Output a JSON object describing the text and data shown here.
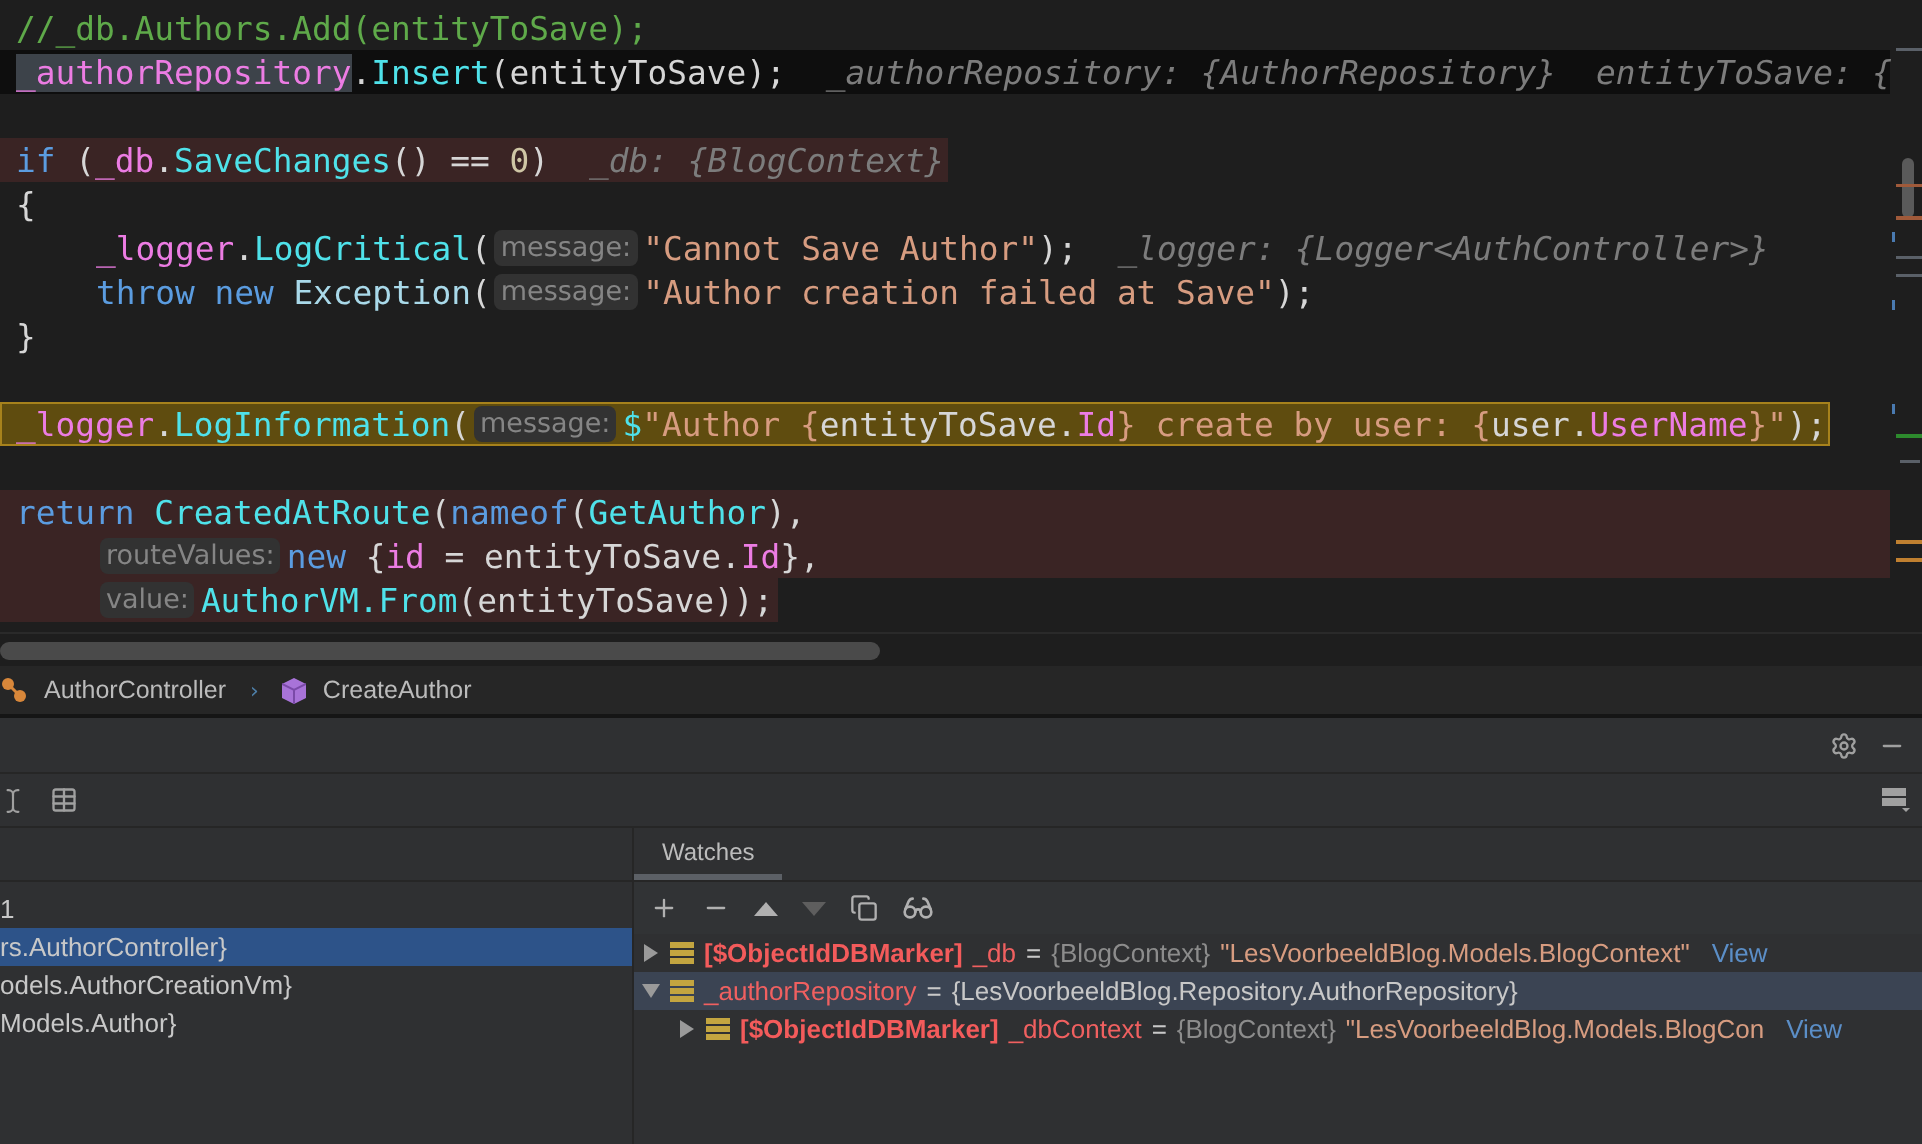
{
  "editor": {
    "lines": [
      {
        "kind": "plain",
        "tokens": [
          {
            "kind": "comment",
            "text": "//_db.Authors.Add(entityToSave);"
          }
        ]
      },
      {
        "kind": "current",
        "tokens": [
          {
            "kind": "field-selected",
            "text": "_authorRepository"
          },
          {
            "kind": "plain",
            "text": "."
          },
          {
            "kind": "method",
            "text": "Insert"
          },
          {
            "kind": "plain",
            "text": "(entityToSave);"
          },
          {
            "kind": "inline",
            "text": "_authorRepository: {AuthorRepository}"
          },
          {
            "kind": "inline",
            "text": "entityToSave: {"
          }
        ]
      },
      {
        "kind": "plain"
      },
      {
        "kind": "breakpoint",
        "tokens": [
          {
            "kind": "keyword",
            "text": "if"
          },
          {
            "kind": "plain",
            "text": " ("
          },
          {
            "kind": "field",
            "text": "_db"
          },
          {
            "kind": "plain",
            "text": "."
          },
          {
            "kind": "method",
            "text": "SaveChanges"
          },
          {
            "kind": "plain",
            "text": "() == "
          },
          {
            "kind": "number",
            "text": "0"
          },
          {
            "kind": "plain",
            "text": ")"
          },
          {
            "kind": "inline",
            "text": "_db: {BlogContext}"
          }
        ]
      },
      {
        "kind": "plain",
        "tokens": [
          {
            "kind": "plain",
            "text": "{"
          }
        ]
      },
      {
        "kind": "plain",
        "indented": true,
        "tokens": [
          {
            "kind": "field",
            "text": "_logger"
          },
          {
            "kind": "plain",
            "text": "."
          },
          {
            "kind": "method",
            "text": "LogCritical"
          },
          {
            "kind": "plain",
            "text": "("
          },
          {
            "kind": "hint",
            "text": "message:"
          },
          {
            "kind": "string",
            "text": "\"Cannot Save Author\""
          },
          {
            "kind": "plain",
            "text": ");"
          },
          {
            "kind": "inline",
            "text": "_logger: {Logger<AuthController>}"
          }
        ]
      },
      {
        "kind": "plain",
        "indented": true,
        "tokens": [
          {
            "kind": "keyword",
            "text": "throw new "
          },
          {
            "kind": "type",
            "text": "Exception"
          },
          {
            "kind": "plain",
            "text": "("
          },
          {
            "kind": "hint",
            "text": "message:"
          },
          {
            "kind": "string",
            "text": "\"Author creation failed at Save\""
          },
          {
            "kind": "plain",
            "text": ");"
          }
        ]
      },
      {
        "kind": "plain",
        "tokens": [
          {
            "kind": "plain",
            "text": "}"
          }
        ]
      },
      {
        "kind": "plain"
      },
      {
        "kind": "logpoint",
        "tokens": [
          {
            "kind": "field",
            "text": "_logger"
          },
          {
            "kind": "plain",
            "text": "."
          },
          {
            "kind": "method",
            "text": "LogInformation"
          },
          {
            "kind": "plain",
            "text": "("
          },
          {
            "kind": "hint",
            "text": "message:"
          },
          {
            "kind": "method",
            "text": "$"
          },
          {
            "kind": "string",
            "text": "\"Author {"
          },
          {
            "kind": "plain",
            "text": "entityToSave."
          },
          {
            "kind": "field",
            "text": "Id"
          },
          {
            "kind": "string",
            "text": "} create by user: {"
          },
          {
            "kind": "plain",
            "text": "user."
          },
          {
            "kind": "field",
            "text": "UserName"
          },
          {
            "kind": "string",
            "text": "}\""
          },
          {
            "kind": "plain",
            "text": ");"
          }
        ]
      },
      {
        "kind": "plain"
      },
      {
        "kind": "breakpoint-block",
        "tokens": [
          {
            "kind": "keyword",
            "text": "return "
          },
          {
            "kind": "method",
            "text": "CreatedAtRoute"
          },
          {
            "kind": "plain",
            "text": "("
          },
          {
            "kind": "keyword",
            "text": "nameof"
          },
          {
            "kind": "plain",
            "text": "("
          },
          {
            "kind": "method",
            "text": "GetAuthor"
          },
          {
            "kind": "plain",
            "text": "),"
          }
        ]
      },
      {
        "kind": "breakpoint-block",
        "indented": true,
        "tokens": [
          {
            "kind": "hint",
            "text": "routeValues:"
          },
          {
            "kind": "keyword",
            "text": "new "
          },
          {
            "kind": "plain",
            "text": "{"
          },
          {
            "kind": "field",
            "text": "id"
          },
          {
            "kind": "plain",
            "text": " = entityToSave."
          },
          {
            "kind": "field",
            "text": "Id"
          },
          {
            "kind": "plain",
            "text": "},"
          }
        ]
      },
      {
        "kind": "breakpoint",
        "indented": true,
        "tokens": [
          {
            "kind": "hint",
            "text": "value:"
          },
          {
            "kind": "method",
            "text": "AuthorVM."
          },
          {
            "kind": "method",
            "text": "From"
          },
          {
            "kind": "plain",
            "text": "(entityToSave));"
          }
        ]
      }
    ]
  },
  "breadcrumb": {
    "separator": "›",
    "items": [
      {
        "kind": "class",
        "label": "AuthorController"
      },
      {
        "kind": "method",
        "label": "CreateAuthor"
      }
    ]
  },
  "variables": {
    "rows": [
      {
        "text": "1",
        "selected": false
      },
      {
        "text": "rs.AuthorController}",
        "selected": true
      },
      {
        "text": "odels.AuthorCreationVm}",
        "selected": false
      },
      {
        "text": "Models.Author}",
        "selected": false
      }
    ]
  },
  "watches": {
    "tabs": [
      {
        "label": "Watches",
        "selected": true
      }
    ],
    "items": [
      {
        "marker": "[$ObjectIdDBMarker]",
        "name": "_db",
        "operator": "=",
        "type": "{BlogContext}",
        "value": "\"LesVoorbeeldBlog.Models.BlogContext\"",
        "link": "View",
        "expanded": false,
        "selected": false
      },
      {
        "name": "_authorRepository",
        "operator": "=",
        "value": "{LesVoorbeeldBlog.Repository.AuthorRepository}",
        "expanded": true,
        "selected": true,
        "children": [
          {
            "marker": "[$ObjectIdDBMarker]",
            "name": "_dbContext",
            "operator": "=",
            "type": "{BlogContext}",
            "value": "\"LesVoorbeeldBlog.Models.BlogCon",
            "link": "View",
            "expanded": false,
            "selected": false
          }
        ]
      }
    ]
  }
}
